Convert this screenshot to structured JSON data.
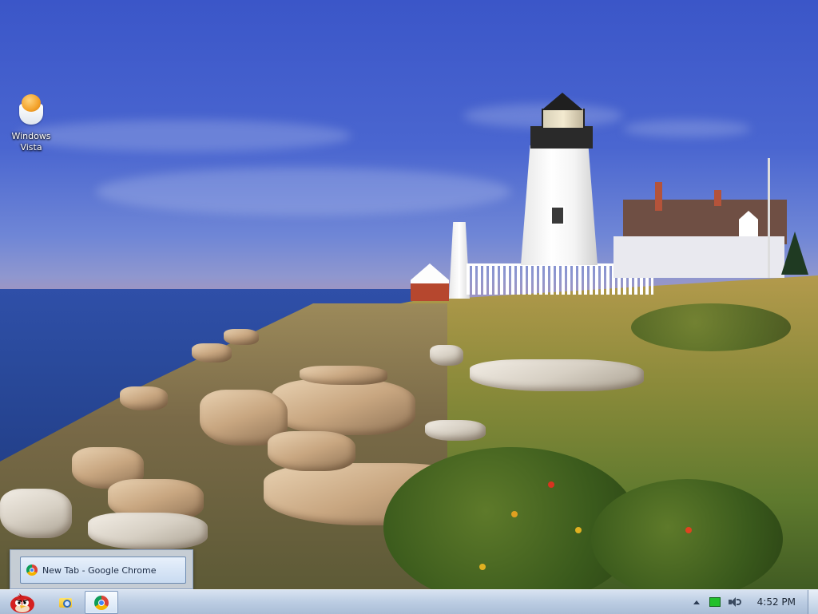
{
  "desktop": {
    "icons": [
      {
        "label": "Windows Vista",
        "icon": "egg-cup-icon"
      }
    ]
  },
  "taskbar": {
    "start_icon": "angry-bird-icon",
    "pinned": [
      {
        "icon": "windows-explorer-icon",
        "active": false
      },
      {
        "icon": "google-chrome-icon",
        "active": true
      }
    ],
    "thumbnail_popup": {
      "title": "New Tab - Google Chrome",
      "icon": "google-chrome-icon"
    },
    "tray": {
      "icons": [
        "show-hidden-icons-arrow",
        "battery-icon",
        "volume-icon"
      ],
      "clock": "4:52 PM"
    }
  },
  "colors": {
    "taskbar_top": "#d8e3f1",
    "taskbar_bottom": "#aabdd6",
    "sky": "#3b56c8"
  }
}
